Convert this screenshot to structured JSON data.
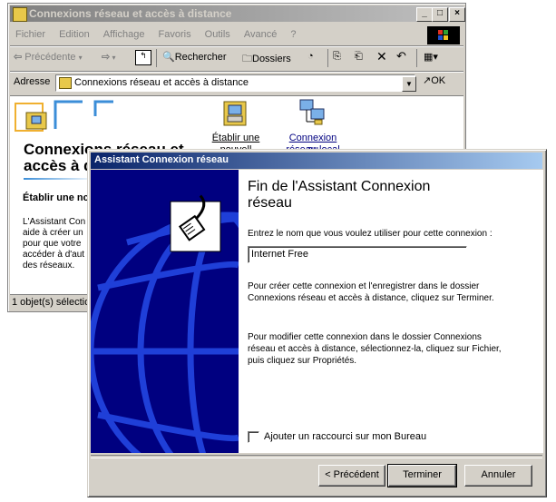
{
  "explorer": {
    "title": "Connexions réseau et accès à distance",
    "menu": [
      "Fichier",
      "Edition",
      "Affichage",
      "Favoris",
      "Outils",
      "Avancé",
      "?"
    ],
    "toolbar": {
      "back_label": "Précédente",
      "search_label": "Rechercher",
      "folders_label": "Dossiers"
    },
    "address": {
      "label": "Adresse",
      "value": "Connexions réseau et accès à distance",
      "go_label": "OK"
    },
    "folder_title_line1": "Connexions réseau et",
    "folder_title_line2": "accès à d",
    "side_heading": "Établir une nc",
    "side_body": [
      "L'Assistant Con",
      "aide à créer un",
      "pour que votre",
      "accéder à d'aut",
      "des réseaux."
    ],
    "icons": [
      {
        "label_line1": "Établir une",
        "label_line2": "nouvell"
      },
      {
        "label_line1": "Connexion au",
        "label_line2": "réseau local"
      }
    ],
    "status": "1 objet(s) sélection"
  },
  "wizard": {
    "title": "Assistant Connexion réseau",
    "heading_line1": "Fin de l'Assistant Connexion",
    "heading_line2": "réseau",
    "prompt": "Entrez le nom que vous voulez utiliser pour cette connexion :",
    "connection_name": "Internet Free",
    "para1_line1": "Pour créer cette connexion et l'enregistrer dans le dossier",
    "para1_line2": "Connexions réseau et accès à distance, cliquez sur Terminer.",
    "para2_line1": "Pour modifier cette connexion dans le dossier Connexions",
    "para2_line2": "réseau et accès à distance, sélectionnez-la, cliquez sur Fichier,",
    "para2_line3": "puis cliquez sur Propriétés.",
    "checkbox_label": "Ajouter un raccourci sur mon Bureau",
    "checkbox_checked": false,
    "buttons": {
      "back": "< Précédent",
      "finish": "Terminer",
      "cancel": "Annuler"
    }
  },
  "colors": {
    "title_active": "#0a246a",
    "title_inactive": "#808080",
    "wizard_panel": "#000080",
    "face": "#d4d0c8"
  }
}
